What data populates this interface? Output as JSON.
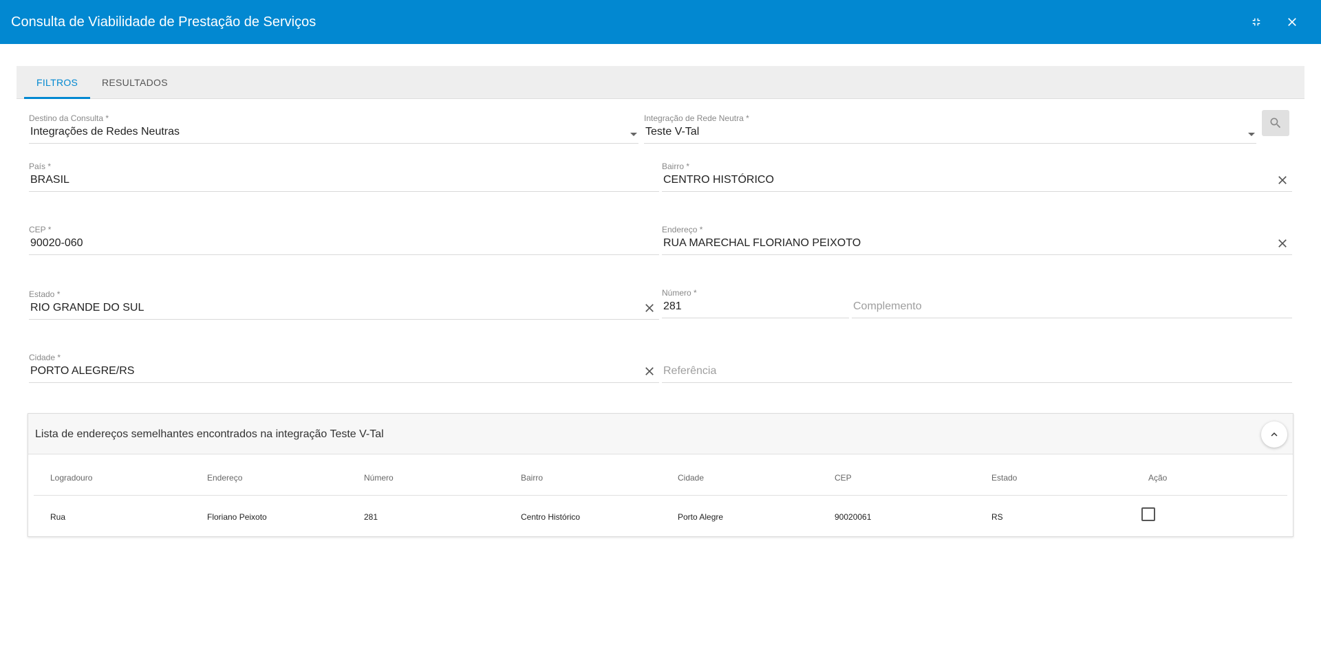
{
  "window": {
    "title": "Consulta de Viabilidade de Prestação de Serviços",
    "minimize_icon": "fullscreen-exit-icon",
    "close_icon": "close-icon"
  },
  "tabs": [
    {
      "label": "FILTROS",
      "active": true
    },
    {
      "label": "RESULTADOS",
      "active": false
    }
  ],
  "form": {
    "destino": {
      "label": "Destino da Consulta *",
      "value": "Integrações de Redes Neutras"
    },
    "integracao": {
      "label": "Integração de Rede Neutra *",
      "value": "Teste V-Tal"
    },
    "pais": {
      "label": "País *",
      "value": "BRASIL"
    },
    "bairro": {
      "label": "Bairro *",
      "value": "CENTRO HISTÓRICO"
    },
    "cep": {
      "label": "CEP *",
      "value": "90020-060"
    },
    "endereco": {
      "label": "Endereço *",
      "value": "RUA MARECHAL FLORIANO PEIXOTO"
    },
    "estado": {
      "label": "Estado *",
      "value": "RIO GRANDE DO SUL"
    },
    "numero": {
      "label": "Número *",
      "value": "281"
    },
    "complemento": {
      "placeholder": "Complemento"
    },
    "cidade": {
      "label": "Cidade *",
      "value": "PORTO ALEGRE/RS"
    },
    "referencia": {
      "placeholder": "Referência"
    }
  },
  "results_panel": {
    "title": "Lista de endereços semelhantes encontrados na integração Teste V-Tal",
    "columns": [
      "Logradouro",
      "Endereço",
      "Número",
      "Bairro",
      "Cidade",
      "CEP",
      "Estado",
      "Ação"
    ],
    "rows": [
      [
        "Rua",
        "Floriano Peixoto",
        "281",
        "Centro Histórico",
        "Porto Alegre",
        "90020061",
        "RS"
      ]
    ]
  },
  "colors": {
    "primary": "#0288d1",
    "tab_bar": "#eeeeee"
  }
}
